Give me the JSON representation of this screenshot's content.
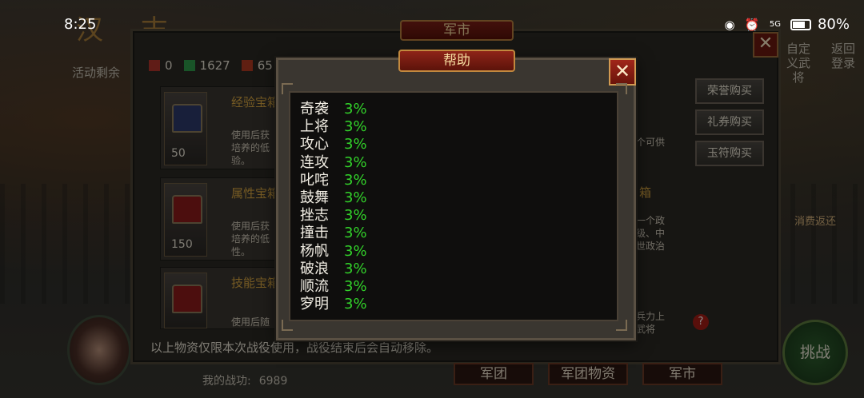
{
  "status_bar": {
    "time": "8:25",
    "network": "5G",
    "battery": "80%"
  },
  "background": {
    "activity_text": "活动剩余",
    "right_links": [
      "自定义武将",
      "返回登录"
    ],
    "consume_label": "消费返还"
  },
  "market": {
    "title": "军市",
    "close_label": "✕",
    "resources": [
      {
        "icon": "flag-icon",
        "value": "0",
        "color": "#b0332a"
      },
      {
        "icon": "jade-icon",
        "value": "1627",
        "color": "#2e9a4a"
      },
      {
        "icon": "token-icon",
        "value": "65",
        "color": "#b03a22"
      }
    ],
    "items": [
      {
        "title": "经验宝箱",
        "desc_lines": [
          "使用后获",
          "培养的低",
          "验。"
        ],
        "price": "50",
        "chest_color": "#2d3a6a"
      },
      {
        "title": "属性宝箱",
        "desc_lines": [
          "使用后获",
          "培养的低",
          "性。"
        ],
        "price": "150",
        "chest_color": "#8a1a1a"
      },
      {
        "title": "技能宝箱",
        "desc_lines": [
          "使用后随"
        ],
        "price": "",
        "chest_color": "#8a1a1a"
      }
    ],
    "right_fragments": {
      "row1": "个可供",
      "row2_title": "箱",
      "row2_lines": [
        "一个政",
        "级、中",
        "世政治"
      ],
      "row3_lines": [
        "兵力上",
        "武将"
      ]
    },
    "buy_buttons": [
      "荣誉购买",
      "礼券购买",
      "玉符购买"
    ],
    "footer_note": "以上物资仅限本次战役使用，战役结束后会自动移除。",
    "merit_label": "我的战功:",
    "merit_value": "6989",
    "bottom_tabs": [
      "军团",
      "军团物资",
      "军市"
    ],
    "challenge_label": "挑战",
    "hint_label": "?"
  },
  "help": {
    "title": "帮助",
    "close_label": "✕",
    "rows": [
      {
        "name": "奇袭",
        "value": "3%"
      },
      {
        "name": "上将",
        "value": "3%"
      },
      {
        "name": "攻心",
        "value": "3%"
      },
      {
        "name": "连攻",
        "value": "3%"
      },
      {
        "name": "叱咤",
        "value": "3%"
      },
      {
        "name": "鼓舞",
        "value": "3%"
      },
      {
        "name": "挫志",
        "value": "3%"
      },
      {
        "name": "撞击",
        "value": "3%"
      },
      {
        "name": "杨帆",
        "value": "3%"
      },
      {
        "name": "破浪",
        "value": "3%"
      },
      {
        "name": "顺流",
        "value": "3%"
      },
      {
        "name": "穸明",
        "value": "3%"
      }
    ]
  }
}
